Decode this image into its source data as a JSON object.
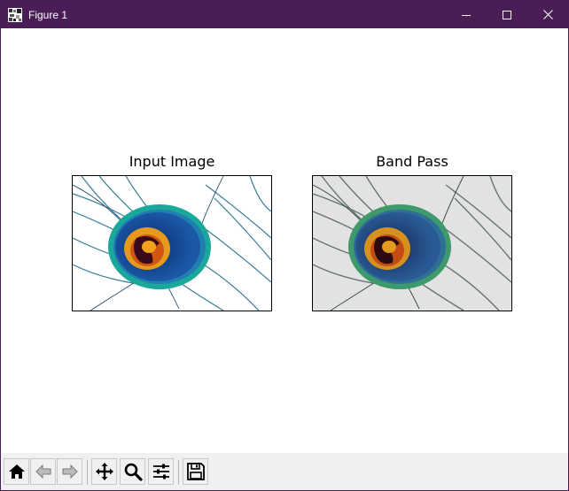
{
  "window": {
    "title": "Figure 1",
    "icon": "figure-app-icon"
  },
  "title_controls": {
    "minimize_icon": "minimize-icon",
    "maximize_icon": "maximize-icon",
    "close_icon": "close-icon"
  },
  "figure": {
    "subplots": [
      {
        "title": "Input Image",
        "image": "peacock-feather-original"
      },
      {
        "title": "Band Pass",
        "image": "peacock-feather-band-pass-filtered"
      }
    ]
  },
  "toolbar": {
    "buttons": [
      {
        "name": "home",
        "icon": "home-icon"
      },
      {
        "name": "back",
        "icon": "arrow-left-icon"
      },
      {
        "name": "forward",
        "icon": "arrow-right-icon"
      },
      {
        "name": "pan",
        "icon": "move-icon"
      },
      {
        "name": "zoom",
        "icon": "magnifier-icon"
      },
      {
        "name": "configure-subplots",
        "icon": "sliders-icon"
      },
      {
        "name": "save",
        "icon": "floppy-disk-icon"
      }
    ]
  },
  "colors": {
    "titlebar": "#4a1d56",
    "toolbar": "#f0f0f0"
  }
}
